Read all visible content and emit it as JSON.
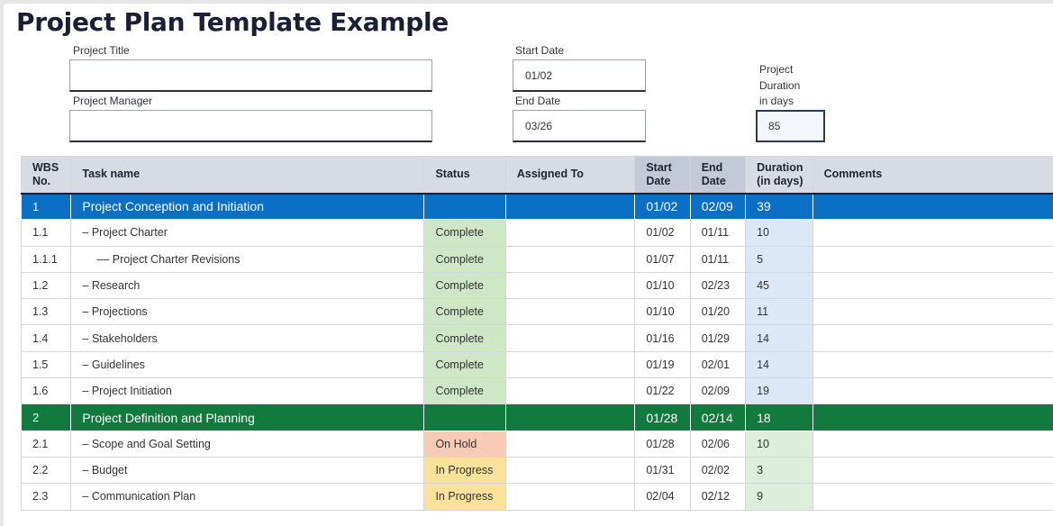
{
  "doc_title": "Project Plan Template Example",
  "fields": {
    "project_title_label": "Project Title",
    "project_title_value": "",
    "project_manager_label": "Project Manager",
    "project_manager_value": "",
    "start_date_label": "Start Date",
    "start_date_value": "01/02",
    "end_date_label": "End Date",
    "end_date_value": "03/26",
    "duration_label_1": "Project",
    "duration_label_2": "Duration",
    "duration_label_3": "in days",
    "duration_value": "85"
  },
  "table": {
    "headers": {
      "wbs_1": "WBS",
      "wbs_2": "No.",
      "task": "Task name",
      "status": "Status",
      "assigned": "Assigned To",
      "start_1": "Start",
      "start_2": "Date",
      "end_1": "End",
      "end_2": "Date",
      "duration_1": "Duration",
      "duration_2": "(in days)",
      "comments": "Comments"
    },
    "rows": [
      {
        "wbs": "1",
        "task": "Project Conception and Initiation",
        "status": "",
        "assigned": "",
        "start": "01/02",
        "end": "02/09",
        "duration": "39",
        "comments": ""
      },
      {
        "wbs": "1.1",
        "task": "– Project Charter",
        "status": "Complete",
        "assigned": "",
        "start": "01/02",
        "end": "01/11",
        "duration": "10",
        "comments": ""
      },
      {
        "wbs": "1.1.1",
        "task": "–– Project Charter Revisions",
        "status": "Complete",
        "assigned": "",
        "start": "01/07",
        "end": "01/11",
        "duration": "5",
        "comments": ""
      },
      {
        "wbs": "1.2",
        "task": "– Research",
        "status": "Complete",
        "assigned": "",
        "start": "01/10",
        "end": "02/23",
        "duration": "45",
        "comments": ""
      },
      {
        "wbs": "1.3",
        "task": "– Projections",
        "status": "Complete",
        "assigned": "",
        "start": "01/10",
        "end": "01/20",
        "duration": "11",
        "comments": ""
      },
      {
        "wbs": "1.4",
        "task": "– Stakeholders",
        "status": "Complete",
        "assigned": "",
        "start": "01/16",
        "end": "01/29",
        "duration": "14",
        "comments": ""
      },
      {
        "wbs": "1.5",
        "task": "– Guidelines",
        "status": "Complete",
        "assigned": "",
        "start": "01/19",
        "end": "02/01",
        "duration": "14",
        "comments": ""
      },
      {
        "wbs": "1.6",
        "task": "– Project Initiation",
        "status": "Complete",
        "assigned": "",
        "start": "01/22",
        "end": "02/09",
        "duration": "19",
        "comments": ""
      },
      {
        "wbs": "2",
        "task": "Project Definition and Planning",
        "status": "",
        "assigned": "",
        "start": "01/28",
        "end": "02/14",
        "duration": "18",
        "comments": ""
      },
      {
        "wbs": "2.1",
        "task": "– Scope and Goal Setting",
        "status": "On Hold",
        "assigned": "",
        "start": "01/28",
        "end": "02/06",
        "duration": "10",
        "comments": ""
      },
      {
        "wbs": "2.2",
        "task": "– Budget",
        "status": "In Progress",
        "assigned": "",
        "start": "01/31",
        "end": "02/02",
        "duration": "3",
        "comments": ""
      },
      {
        "wbs": "2.3",
        "task": "– Communication Plan",
        "status": "In Progress",
        "assigned": "",
        "start": "02/04",
        "end": "02/12",
        "duration": "9",
        "comments": ""
      }
    ]
  },
  "colors": {
    "phase_1": "#0b6fc6",
    "phase_2": "#127a3e",
    "status_complete": "#cfe7c7",
    "status_on_hold": "#f8cbb6",
    "status_in_progress": "#fbe29a"
  }
}
